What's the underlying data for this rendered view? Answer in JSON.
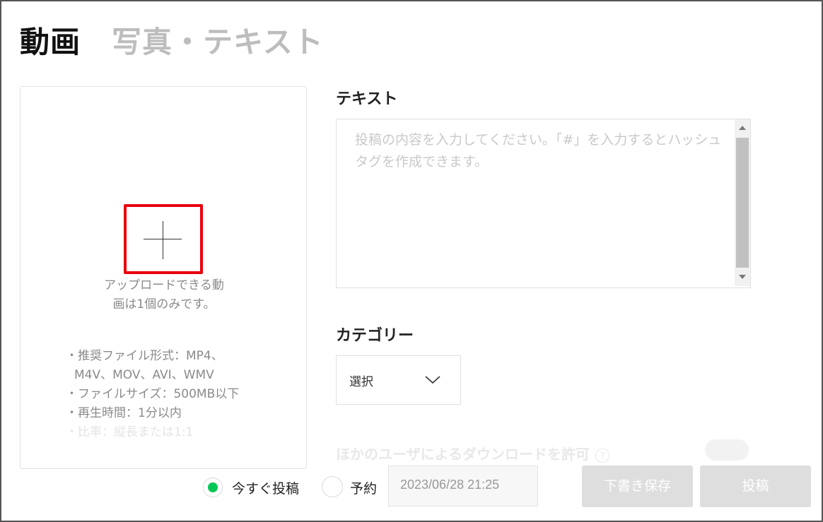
{
  "tabs": {
    "video": "動画",
    "photo_text": "写真・テキスト"
  },
  "upload": {
    "note": "アップロードできる動画は1個のみです。",
    "specs": [
      "・推奨ファイル形式：MP4、M4V、MOV、AVI、WMV",
      "・ファイルサイズ：500MB以下",
      "・再生時間：1分以内",
      "・比率：縦長または1:1"
    ]
  },
  "text_section": {
    "title": "テキスト",
    "placeholder": "投稿の内容を入力してください。「#」を入力するとハッシュタグを作成できます。"
  },
  "category": {
    "title": "カテゴリー",
    "selected": "選択"
  },
  "download": {
    "label": "ほかのユーザによるダウンロードを許可",
    "help": "?"
  },
  "post_timing": {
    "now_label": "今すぐ投稿",
    "schedule_label": "予約",
    "datetime": "2023/06/28 21:25",
    "selected": "now"
  },
  "buttons": {
    "draft": "下書き保存",
    "post": "投稿"
  },
  "colors": {
    "highlight": "#e8000b",
    "radio_on": "#06c755",
    "disabled_button": "#dedede"
  }
}
